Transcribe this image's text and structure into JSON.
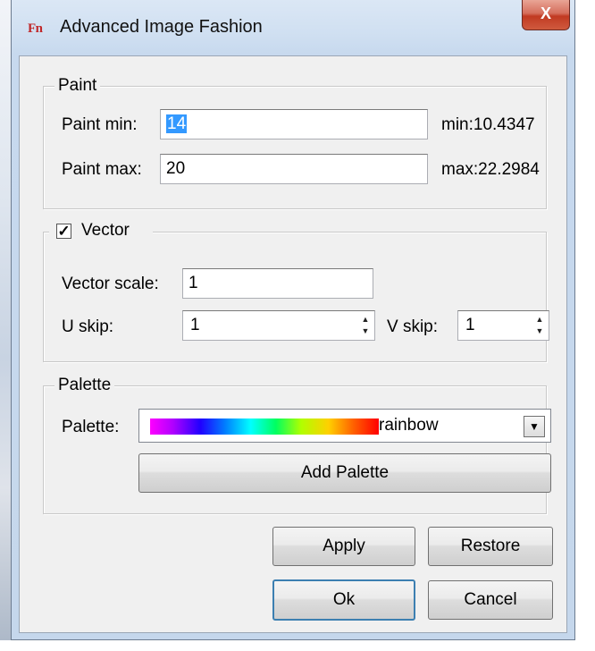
{
  "window": {
    "title": "Advanced Image Fashion",
    "app_icon_text": "Fn",
    "close_glyph": "X"
  },
  "paint": {
    "legend": "Paint",
    "min_label": "Paint min:",
    "min_value": "14",
    "min_info": "min:10.4347",
    "max_label": "Paint max:",
    "max_value": "20",
    "max_info": "max:22.2984"
  },
  "vector": {
    "legend": "Vector",
    "checked": true,
    "check_glyph": "✓",
    "scale_label": "Vector scale:",
    "scale_value": "1",
    "u_skip_label": "U skip:",
    "u_skip_value": "1",
    "v_skip_label": "V skip:",
    "v_skip_value": "1"
  },
  "palette": {
    "legend": "Palette",
    "label": "Palette:",
    "selected": "rainbow",
    "add_button": "Add Palette"
  },
  "buttons": {
    "apply": "Apply",
    "restore": "Restore",
    "ok": "Ok",
    "cancel": "Cancel"
  }
}
